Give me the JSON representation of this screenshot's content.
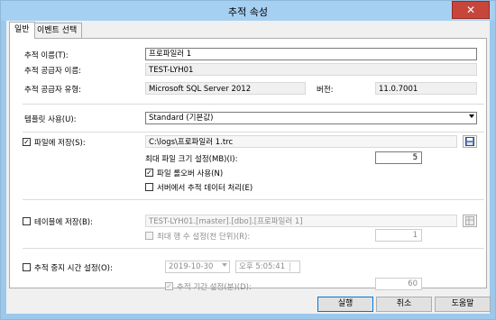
{
  "window": {
    "title": "추적 속성",
    "close_glyph": "✕"
  },
  "tabs": [
    {
      "label": "일반",
      "active": true
    },
    {
      "label": "이벤트 선택",
      "active": false
    }
  ],
  "general": {
    "trace_name": {
      "label": "추적 이름(T):",
      "value": "프로파일러 1"
    },
    "trace_provider_name": {
      "label": "추적 공급자 이름:",
      "value": "TEST-LYH01"
    },
    "trace_provider_type": {
      "label": "추적 공급자 유형:",
      "value": "Microsoft SQL Server 2012"
    },
    "version": {
      "label": "버전:",
      "value": "11.0.7001"
    },
    "template": {
      "label": "템플릿 사용(U):",
      "value": "Standard (기본값)"
    },
    "save_to_file": {
      "label": "파일에 저장(S):",
      "checked": true,
      "path": "C:\\logs\\프로파일러 1.trc",
      "max_file_size": {
        "label": "최대 파일 크기 설정(MB)(I):",
        "value": "5"
      },
      "enable_rollover": {
        "label": "파일 롤오버 사용(N)",
        "checked": true
      },
      "server_process": {
        "label": "서버에서 추적 데이터 처리(E)",
        "checked": false
      }
    },
    "save_to_table": {
      "label": "테이블에 저장(B):",
      "checked": false,
      "value": "TEST-LYH01.[master].[dbo].[프로파일러 1]",
      "max_rows": {
        "label": "최대 행 수 설정(천 단위)(R):",
        "value": "1",
        "checked": false
      }
    },
    "stop_time": {
      "label": "추적 중지 시간 설정(O):",
      "checked": false,
      "date": "2019-10-30",
      "time": "오후   5:05:41",
      "duration": {
        "label": "추적 기간 설정(분)(D):",
        "value": "60",
        "checked": true
      }
    }
  },
  "buttons": {
    "run": "실행",
    "cancel": "취소",
    "help": "도움말"
  },
  "colors": {
    "titlebar": "#a6d0f2",
    "close": "#c7463c",
    "primary_border": "#0078d7"
  }
}
